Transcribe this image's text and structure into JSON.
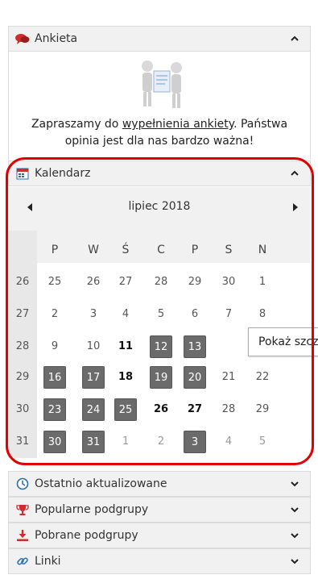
{
  "panels": {
    "survey": {
      "title": "Ankieta",
      "icon": "speech-bubbles-icon",
      "expanded": true
    },
    "calendar": {
      "title": "Kalendarz",
      "icon": "calendar-icon",
      "expanded": true
    },
    "recent": {
      "title": "Ostatnio aktualizowane",
      "icon": "clock-icon"
    },
    "popular": {
      "title": "Popularne podgrupy",
      "icon": "trophy-icon"
    },
    "downloaded": {
      "title": "Pobrane podgrupy",
      "icon": "download-icon"
    },
    "links": {
      "title": "Linki",
      "icon": "link-icon"
    }
  },
  "survey": {
    "text_before": "Zapraszamy do ",
    "link_text": "wypełnienia ankiety",
    "text_after": ". Państwa",
    "line2": "opinia jest dla nas bardzo ważna!"
  },
  "calendar": {
    "month_title": "lipiec 2018",
    "weekdays": [
      "P",
      "W",
      "Ś",
      "C",
      "P",
      "S",
      "N"
    ],
    "weeks": [
      "26",
      "27",
      "28",
      "29",
      "30",
      "31"
    ],
    "rows": [
      [
        {
          "d": "25"
        },
        {
          "d": "26"
        },
        {
          "d": "27"
        },
        {
          "d": "28"
        },
        {
          "d": "29"
        },
        {
          "d": "30"
        },
        {
          "d": "1"
        }
      ],
      [
        {
          "d": "2"
        },
        {
          "d": "3"
        },
        {
          "d": "4"
        },
        {
          "d": "5"
        },
        {
          "d": "6"
        },
        {
          "d": "7"
        },
        {
          "d": "8"
        }
      ],
      [
        {
          "d": "9"
        },
        {
          "d": "10"
        },
        {
          "d": "11",
          "s": "bold"
        },
        {
          "d": "12",
          "s": "hl"
        },
        {
          "d": "13",
          "s": "hl"
        },
        {
          "d": ""
        },
        {
          "d": ""
        }
      ],
      [
        {
          "d": "16",
          "s": "hl"
        },
        {
          "d": "17",
          "s": "hl"
        },
        {
          "d": "18",
          "s": "bold"
        },
        {
          "d": "19",
          "s": "hl"
        },
        {
          "d": "20",
          "s": "hl"
        },
        {
          "d": "21"
        },
        {
          "d": "22"
        }
      ],
      [
        {
          "d": "23",
          "s": "hl"
        },
        {
          "d": "24",
          "s": "hl"
        },
        {
          "d": "25",
          "s": "hl"
        },
        {
          "d": "26",
          "s": "bold"
        },
        {
          "d": "27",
          "s": "bold"
        },
        {
          "d": "28"
        },
        {
          "d": "29"
        }
      ],
      [
        {
          "d": "30",
          "s": "hl"
        },
        {
          "d": "31",
          "s": "hl"
        },
        {
          "d": "1",
          "s": "muted"
        },
        {
          "d": "2",
          "s": "muted"
        },
        {
          "d": "3",
          "s": "hl"
        },
        {
          "d": "4",
          "s": "muted"
        },
        {
          "d": "5",
          "s": "muted"
        }
      ]
    ],
    "tooltip": "Pokaż szcz"
  },
  "colors": {
    "highlight_box": "#6b6b6b",
    "red_outline": "#e10000",
    "header_bg": "#f1f1f1"
  }
}
